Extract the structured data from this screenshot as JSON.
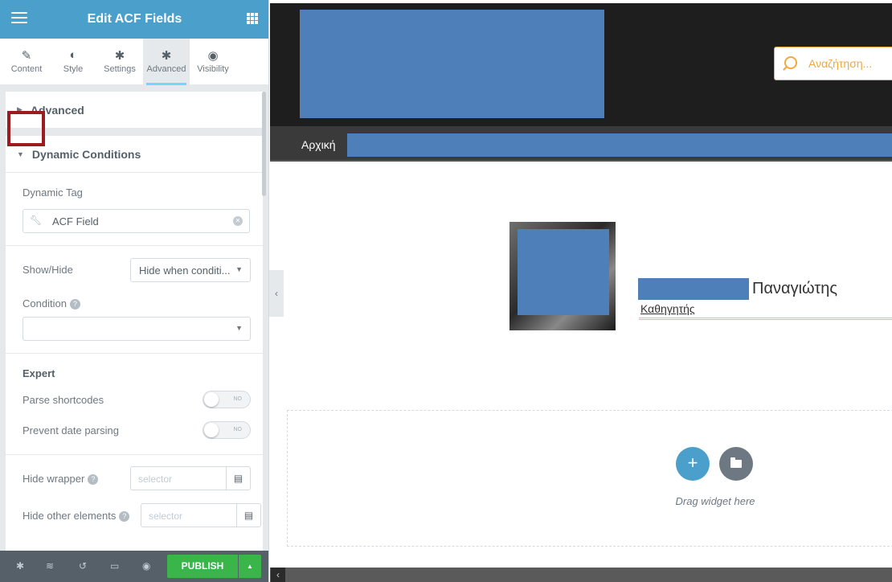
{
  "panel": {
    "title": "Edit ACF Fields",
    "tabs": [
      {
        "label": "Content",
        "icon": "pencil-icon",
        "glyph": "✎"
      },
      {
        "label": "Style",
        "icon": "half-circle-icon",
        "glyph": "◐"
      },
      {
        "label": "Settings",
        "icon": "gear-icon",
        "glyph": "✱"
      },
      {
        "label": "Advanced",
        "icon": "gear-icon",
        "glyph": "✱"
      },
      {
        "label": "Visibility",
        "icon": "eye-icon",
        "glyph": "◉"
      }
    ],
    "active_tab": "Advanced",
    "sections": {
      "advanced": "Advanced",
      "dynamic_conditions": "Dynamic Conditions"
    },
    "dynamic_tag": {
      "label": "Dynamic Tag",
      "value": "ACF Field"
    },
    "show_hide": {
      "label": "Show/Hide",
      "value": "Hide when conditi..."
    },
    "condition": {
      "label": "Condition",
      "value": ""
    },
    "expert": {
      "label": "Expert",
      "parse_shortcodes": "Parse shortcodes",
      "prevent_date_parsing": "Prevent date parsing",
      "toggle_off": "NO"
    },
    "hide_wrapper": {
      "label": "Hide wrapper",
      "placeholder": "selector"
    },
    "hide_other": {
      "label": "Hide other elements",
      "placeholder": "selector"
    },
    "footer": {
      "publish": "PUBLISH"
    }
  },
  "preview": {
    "search_placeholder": "Αναζήτηση...",
    "nav_home": "Αρχική",
    "person_name": "Παναγιώτης",
    "person_title": "Καθηγητής",
    "drag_text": "Drag widget here",
    "redaction_color": "#4f7fb8"
  },
  "colors": {
    "panel_header": "#4a9fcb",
    "publish": "#39b54a",
    "highlight": "#9b1b1f",
    "search_accent": "#f0a93d"
  }
}
